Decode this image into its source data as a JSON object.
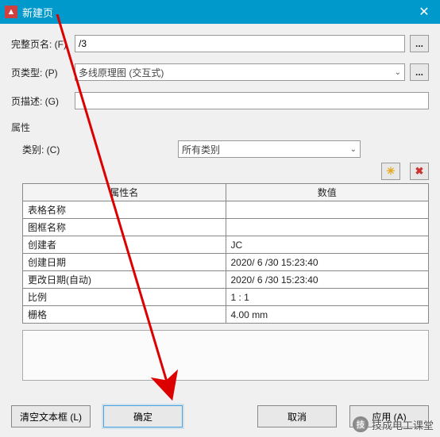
{
  "title": "新建页",
  "close_glyph": "✕",
  "form": {
    "fullname_label": "完整页名: (F)",
    "fullname_value": "/3",
    "type_label": "页类型: (P)",
    "type_value": "多线原理图 (交互式)",
    "desc_label": "页描述: (G)",
    "desc_value": ""
  },
  "props": {
    "group_title": "属性",
    "cat_label": "类别: (C)",
    "cat_value": "所有类别",
    "new_icon": "✳",
    "del_icon": "✖",
    "col_name": "属性名",
    "col_value": "数值",
    "rows": [
      {
        "name": "表格名称",
        "value": ""
      },
      {
        "name": "图框名称",
        "value": ""
      },
      {
        "name": "创建者",
        "value": "JC"
      },
      {
        "name": "创建日期",
        "value": "2020/ 6 /30 15:23:40"
      },
      {
        "name": "更改日期(自动)",
        "value": "2020/ 6 /30 15:23:40"
      },
      {
        "name": "比例",
        "value": "1 : 1"
      },
      {
        "name": "栅格",
        "value": "4.00 mm"
      }
    ]
  },
  "buttons": {
    "clear": "清空文本框 (L)",
    "ok": "确定",
    "cancel": "取消",
    "apply": "应用 (A)"
  },
  "ellipsis": "...",
  "chevron": "⌄",
  "watermark": "技成电工课堂"
}
